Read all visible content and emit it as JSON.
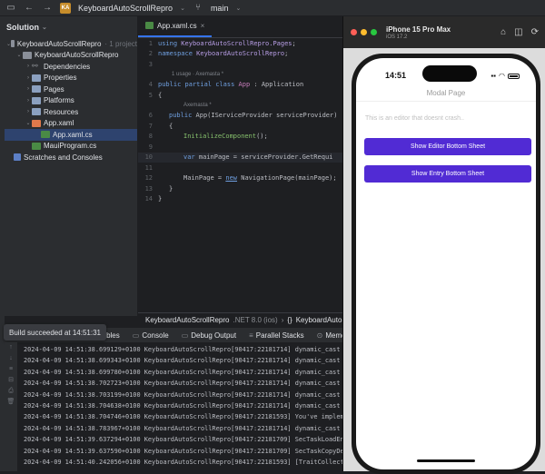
{
  "toolbar": {
    "project_badge": "KA",
    "project_name": "KeyboardAutoScrollRepro",
    "branch": "main"
  },
  "solution": {
    "header": "Solution",
    "items": [
      {
        "label": "KeyboardAutoScrollRepro",
        "note": "· 1 project",
        "icon": "solution-icon",
        "arrow": "⌄"
      },
      {
        "label": "KeyboardAutoScrollRepro",
        "note": "",
        "icon": "project-icon",
        "arrow": "⌄"
      },
      {
        "label": "Dependencies",
        "note": "",
        "icon": "dependencies-icon",
        "arrow": "›"
      },
      {
        "label": "Properties",
        "note": "",
        "icon": "folder-icon",
        "arrow": "›"
      },
      {
        "label": "Pages",
        "note": "",
        "icon": "folder-icon",
        "arrow": "›"
      },
      {
        "label": "Platforms",
        "note": "",
        "icon": "folder-icon",
        "arrow": "›"
      },
      {
        "label": "Resources",
        "note": "",
        "icon": "folder-icon",
        "arrow": "›"
      },
      {
        "label": "App.xaml",
        "note": "",
        "icon": "xaml-file-icon",
        "arrow": "⌄"
      },
      {
        "label": "App.xaml.cs",
        "note": "",
        "icon": "csharp-file-icon",
        "arrow": ""
      },
      {
        "label": "MauiProgram.cs",
        "note": "",
        "icon": "csharp-file-icon",
        "arrow": ""
      },
      {
        "label": "Scratches and Consoles",
        "note": "",
        "icon": "scratches-icon",
        "arrow": ""
      }
    ]
  },
  "editor": {
    "tab_label": "App.xaml.cs",
    "hint_usages": "1 usage  ·  Axemasta *",
    "hint_author": "Axemasta *",
    "line_numbers": [
      "1",
      "2",
      "3",
      "4",
      "5",
      "6",
      "7",
      "8",
      "9",
      "10",
      "11",
      "12",
      "13",
      "14"
    ],
    "code": {
      "l1_kw": "using",
      "l1_ns": "KeyboardAutoScrollRepro.Pages",
      "l2_kw": "namespace",
      "l2_ns": "KeyboardAutoScrollRepro",
      "l4_kw": "public partial class",
      "l4_type": "App",
      "l4_rest": ": Application",
      "l5": "{",
      "l6_kw": "public",
      "l6_rest": "App(IServiceProvider serviceProvider)",
      "l7": "{",
      "l8_fn": "InitializeComponent",
      "l8_rest": "();",
      "l10_kw": "var",
      "l10_rest": "mainPage = serviceProvider.GetRequi",
      "l12_a": "MainPage =",
      "l12_kw": "new",
      "l12_rest": "NavigationPage(mainPage);",
      "l13": "}",
      "l14": "}"
    }
  },
  "breadcrumb": {
    "project": "KeyboardAutoScrollRepro",
    "framework": ".NET 8.0 (ios)",
    "namespace": "KeyboardAutoScrollRe"
  },
  "bottom_panel": {
    "tabs": [
      "Variables",
      "Console",
      "Debug Output",
      "Parallel Stacks",
      "Memory"
    ],
    "toast": "Build succeeded at 14:51:31"
  },
  "console_lines": [
    "2024-04-09 14:51:38.699129+0100 KeyboardAutoScrollRepro[90417:22181714] dynamic_cast err",
    "2024-04-09 14:51:38.699343+0100 KeyboardAutoScrollRepro[90417:22181714] dynamic_cast err",
    "2024-04-09 14:51:38.699780+0100 KeyboardAutoScrollRepro[90417:22181714] dynamic_cast err",
    "2024-04-09 14:51:38.702723+0100 KeyboardAutoScrollRepro[90417:22181714] dynamic_cast err",
    "2024-04-09 14:51:38.703199+0100 KeyboardAutoScrollRepro[90417:22181714] dynamic_cast err",
    "2024-04-09 14:51:38.704638+0100 KeyboardAutoScrollRepro[90417:22181714] dynamic_cast err",
    "2024-04-09 14:51:38.704746+0100 KeyboardAutoScrollRepro[90417:22181593] You've implement",
    "2024-04-09 14:51:38.783967+0100 KeyboardAutoScrollRepro[90417:22181714] dynamic_cast err",
    "2024-04-09 14:51:39.637294+0100 KeyboardAutoScrollRepro[90417:22181709] SecTaskLoadEntit",
    "2024-04-09 14:51:39.637590+0100 KeyboardAutoScrollRepro[90417:22181709] SecTaskCopyDebug",
    "2024-04-09 14:51:40.242056+0100 KeyboardAutoScrollRepro[90417:22181593] [TraitCollection]"
  ],
  "simulator": {
    "device": "iPhone 15 Pro Max",
    "os": "iOS 17.2",
    "time": "14:51",
    "nav_title": "Modal Page",
    "editor_placeholder": "This is an editor that doesnt crash..",
    "button1": "Show Editor Bottom Sheet",
    "button2": "Show Entry Bottom Sheet",
    "accent": "#512bd4"
  }
}
